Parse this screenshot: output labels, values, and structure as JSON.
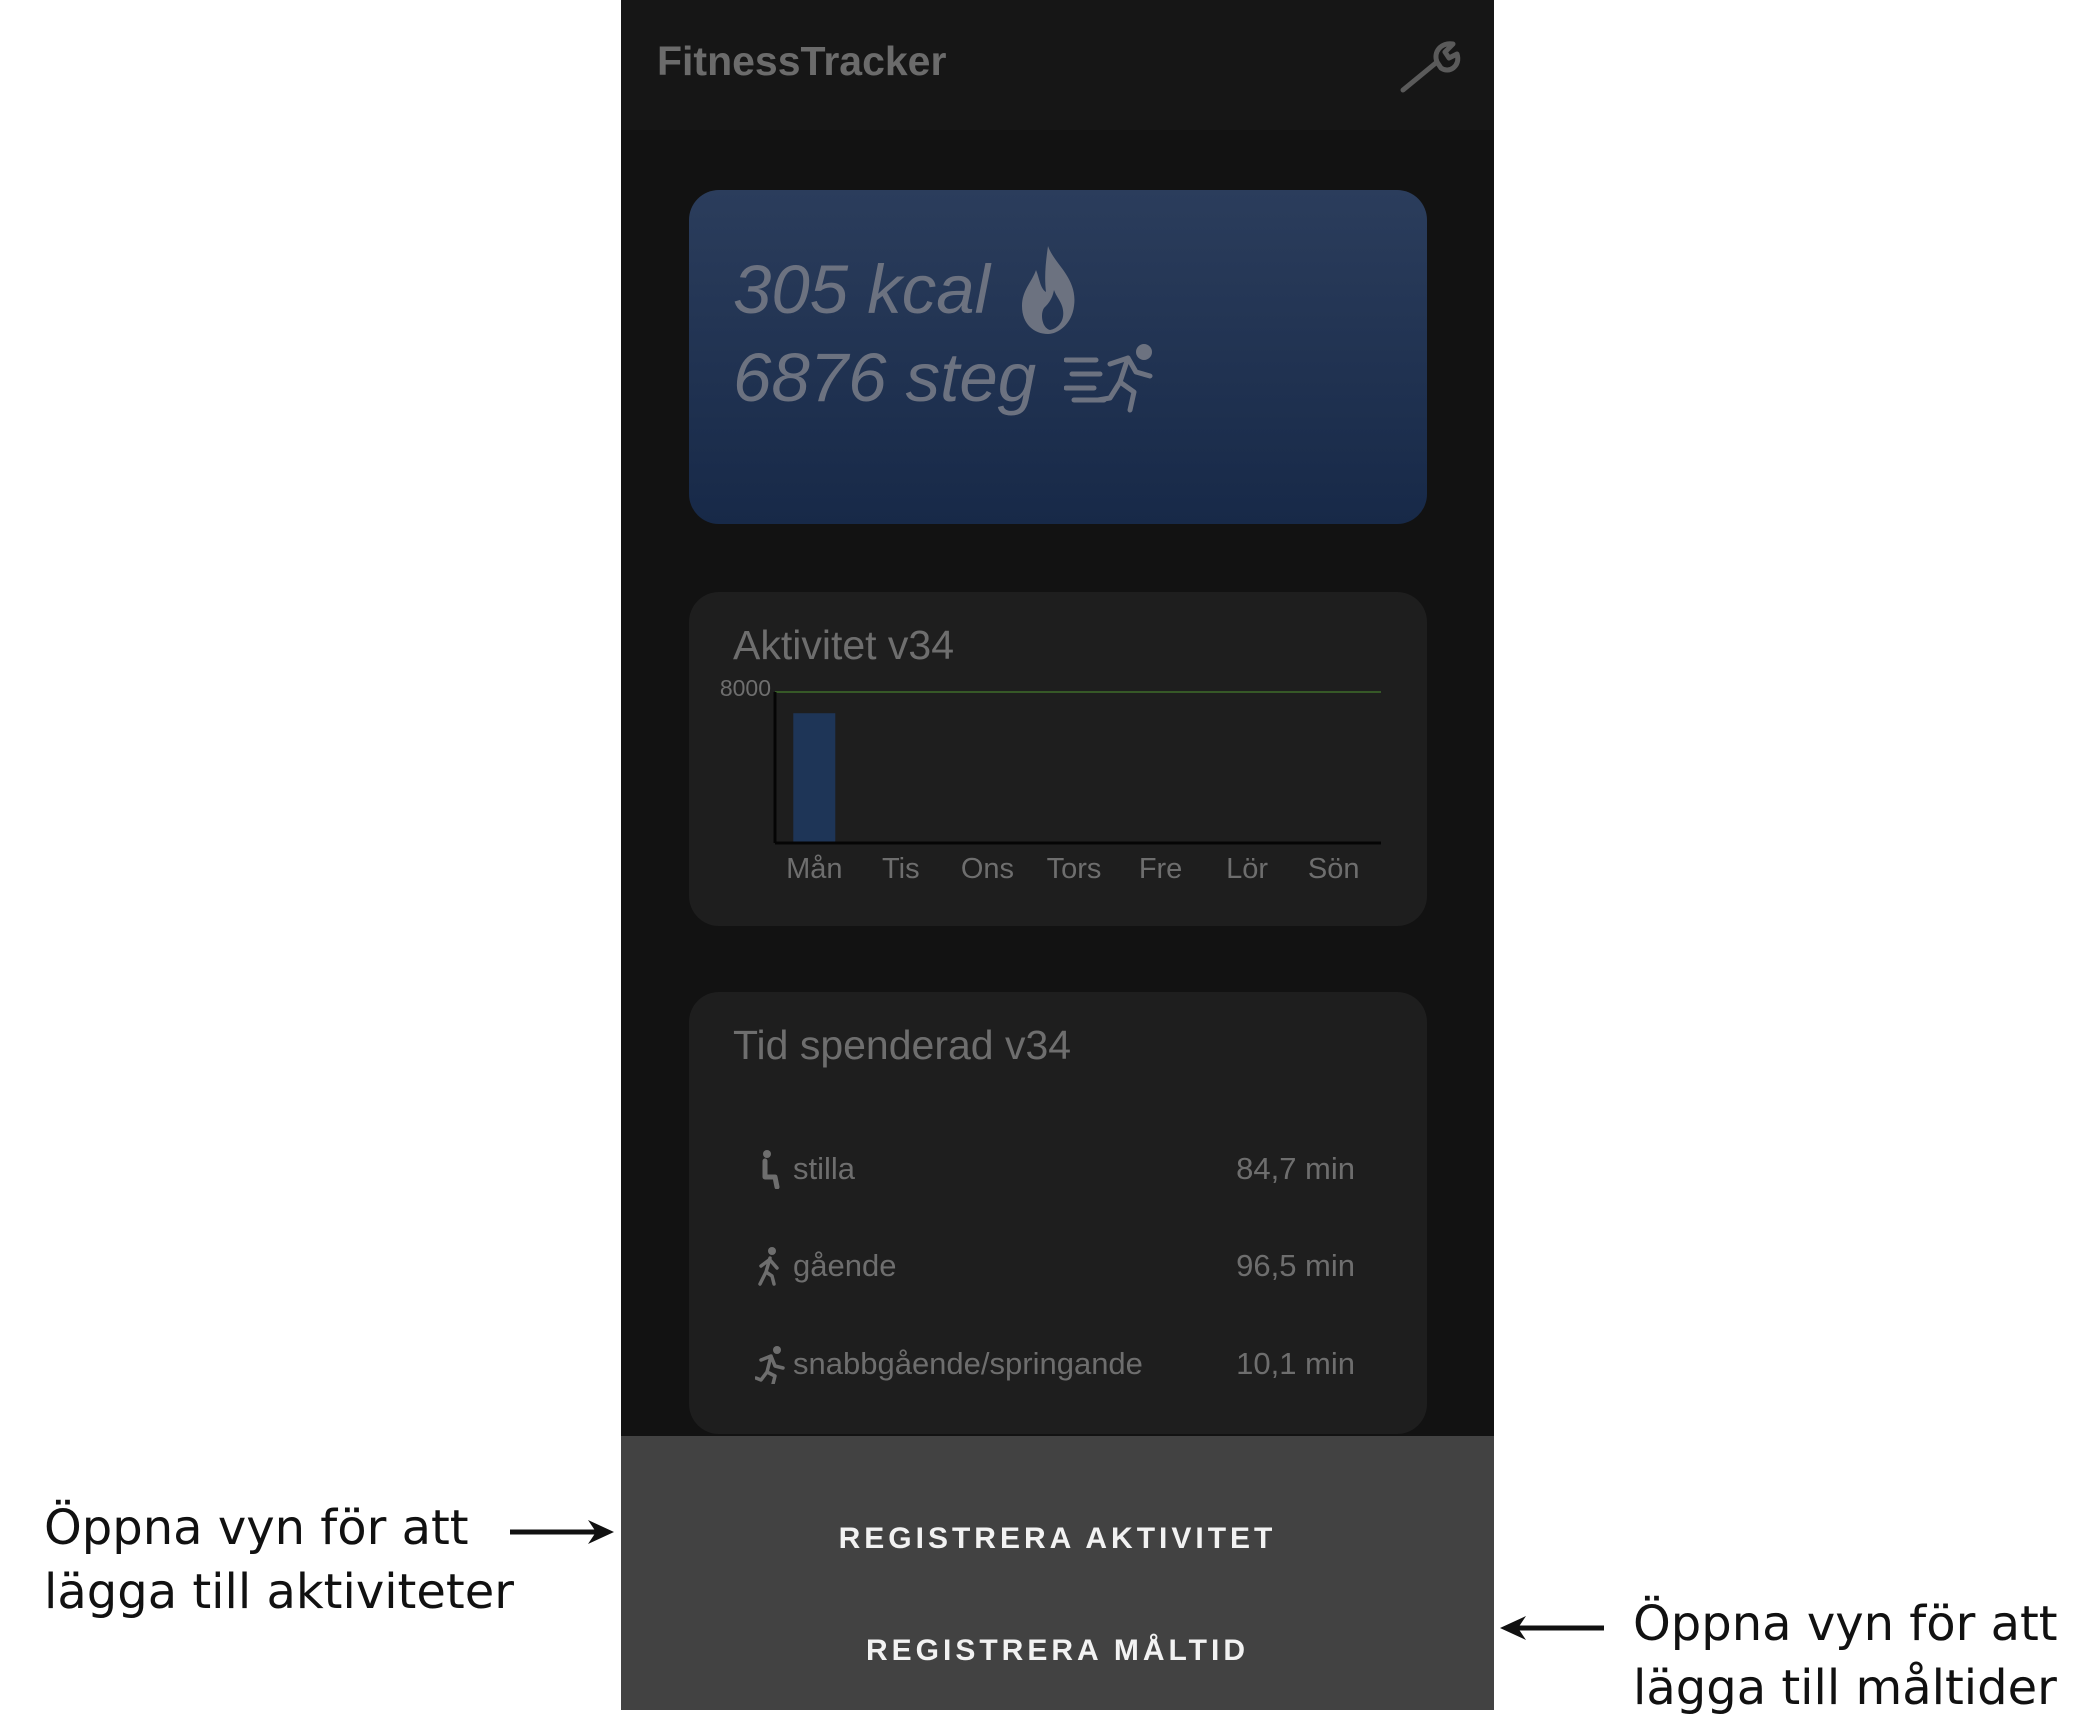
{
  "app": {
    "title": "FitnessTracker"
  },
  "summary": {
    "calories": "305 kcal",
    "steps": "6876 steg"
  },
  "activity_card": {
    "title": "Aktivitet v34"
  },
  "chart_data": {
    "type": "bar",
    "title": "Aktivitet v34",
    "categories": [
      "Mån",
      "Tis",
      "Ons",
      "Tors",
      "Fre",
      "Lör",
      "Sön"
    ],
    "values": [
      6876,
      0,
      0,
      0,
      0,
      0,
      0
    ],
    "ylim": [
      0,
      8000
    ],
    "y_tick_labels": [
      "8000"
    ],
    "goal_line": 8000,
    "grid": false,
    "colors": {
      "bar": "#1e3557",
      "goal": "#3f6b2a",
      "axis": "#050505",
      "label": "#6e6e6e"
    }
  },
  "time_card": {
    "title": "Tid spenderad v34",
    "rows": [
      {
        "icon": "seated-person-icon",
        "label": "stilla",
        "value": "84,7 min"
      },
      {
        "icon": "walking-person-icon",
        "label": "gående",
        "value": "96,5 min"
      },
      {
        "icon": "running-person-icon",
        "label": "snabbgående/springande",
        "value": "10,1 min"
      }
    ]
  },
  "actions": {
    "register_activity": "REGISTRERA AKTIVITET",
    "register_meal": "REGISTRERA MÅLTID"
  },
  "annotations": {
    "left_line1": "Öppna vyn för att",
    "left_line2": "lägga till aktiviteter",
    "right_line1": "Öppna vyn för att",
    "right_line2": "lägga till måltider"
  },
  "icons": {
    "settings": "wrench-icon",
    "calories": "flame-icon",
    "steps": "runner-icon"
  }
}
